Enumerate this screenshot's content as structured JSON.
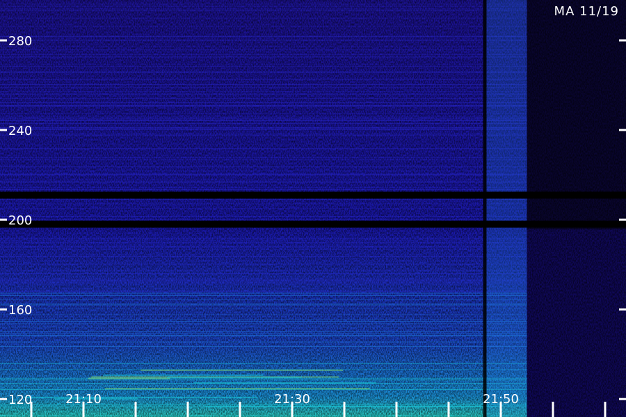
{
  "station_label": "MA 11/19",
  "chart_data": {
    "type": "heatmap",
    "title": "",
    "xlabel": "",
    "ylabel": "",
    "y_ticks": [
      120,
      160,
      200,
      240,
      280
    ],
    "ylim": [
      112,
      298
    ],
    "x_ticks": [
      {
        "label": "21:10",
        "value": 10
      },
      {
        "label": "21:30",
        "value": 30
      },
      {
        "label": "21:50",
        "value": 50
      }
    ],
    "xlim": [
      2,
      62
    ],
    "minor_x_step_minutes": 5,
    "colormap": [
      "#000000",
      "#1a0a8c",
      "#2b2bd6",
      "#1f7fe0",
      "#19c9d8",
      "#7fe07a"
    ],
    "dark_bands_y": [
      198,
      211
    ],
    "signal_end_time": 52.5,
    "grid": false
  }
}
